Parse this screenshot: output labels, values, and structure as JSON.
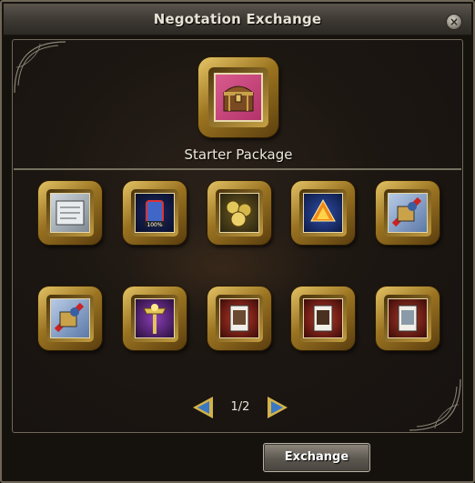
{
  "window": {
    "title": "Negotation Exchange",
    "close_icon": "close-icon"
  },
  "package": {
    "name": "Starter Package",
    "icon": "treasure-chest-icon"
  },
  "rewards": [
    {
      "icon": "scroll-item-icon"
    },
    {
      "icon": "exp-potion-icon"
    },
    {
      "icon": "gold-coin-pile-icon"
    },
    {
      "icon": "fire-crystal-icon"
    },
    {
      "icon": "armor-box-icon"
    },
    {
      "icon": "armor-box-icon"
    },
    {
      "icon": "golden-staff-icon"
    },
    {
      "icon": "ticket-card-icon"
    },
    {
      "icon": "ticket-card-icon"
    },
    {
      "icon": "silver-ticket-icon"
    }
  ],
  "pagination": {
    "page": "1/2"
  },
  "actions": {
    "exchange_label": "Exchange"
  },
  "colors": {
    "gold_frame": "#c49a36",
    "panel_bg": "#1d1712",
    "title_bar": "#3c3832",
    "arrow_blue": "#3a78c4"
  }
}
